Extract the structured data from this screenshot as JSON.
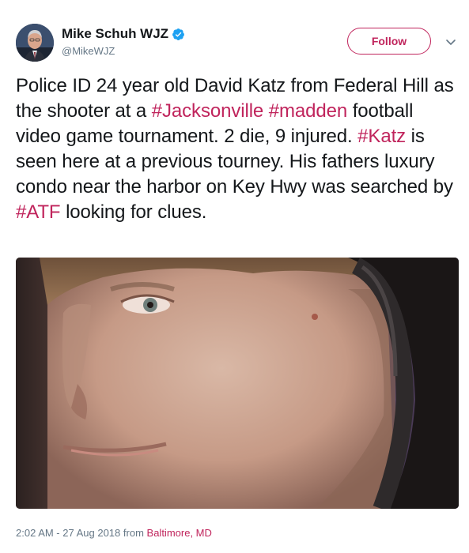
{
  "author": {
    "name": "Mike Schuh WJZ",
    "handle": "@MikeWJZ",
    "verified": true
  },
  "follow_label": "Follow",
  "tweet": {
    "segments": [
      {
        "type": "text",
        "text": "Police ID 24 year old David Katz from Federal Hill as the shooter at a "
      },
      {
        "type": "hashtag",
        "text": "#Jacksonville"
      },
      {
        "type": "text",
        "text": " "
      },
      {
        "type": "hashtag",
        "text": "#madden"
      },
      {
        "type": "text",
        "text": " football video game tournament. 2 die, 9 injured. "
      },
      {
        "type": "hashtag",
        "text": "#Katz"
      },
      {
        "type": "text",
        "text": " is seen here at a previous tourney. His fathers luxury condo near the harbor on Key Hwy was searched by "
      },
      {
        "type": "hashtag",
        "text": "#ATF"
      },
      {
        "type": "text",
        "text": " looking for clues."
      }
    ]
  },
  "footer": {
    "timestamp": "2:02 AM - 27 Aug 2018",
    "from_label": "from",
    "location": "Baltimore, MD"
  },
  "colors": {
    "accent": "#c0245c",
    "verified": "#1da1f2",
    "secondary_text": "#657786"
  },
  "icons": {
    "verified": "verified-badge-icon",
    "caret": "chevron-down-icon"
  }
}
